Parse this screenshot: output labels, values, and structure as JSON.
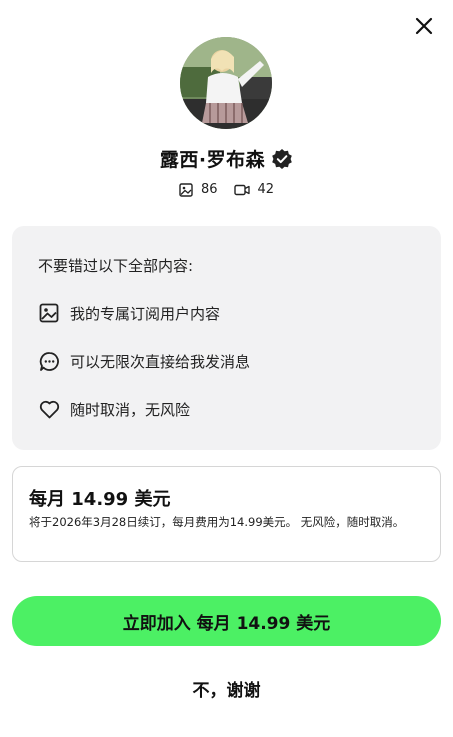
{
  "creator": {
    "name": "露西·罗布森",
    "photo_count": "86",
    "video_count": "42"
  },
  "benefits": {
    "title": "不要错过以下全部内容:",
    "items": [
      {
        "icon": "image-icon",
        "label": "我的专属订阅用户内容"
      },
      {
        "icon": "chat-bubble-icon",
        "label": "可以无限次直接给我发消息"
      },
      {
        "icon": "heart-icon",
        "label": "随时取消，无风险"
      }
    ]
  },
  "plan": {
    "title": "每月 14.99 美元",
    "description": "将于2026年3月28日续订，每月费用为14.99美元。 无风险，随时取消。"
  },
  "actions": {
    "join_label": "立即加入  每月 14.99 美元",
    "decline_label": "不，谢谢"
  },
  "colors": {
    "accent_green": "#4cf064",
    "card_background": "#f2f2f3",
    "verified_badge": "#222222"
  }
}
